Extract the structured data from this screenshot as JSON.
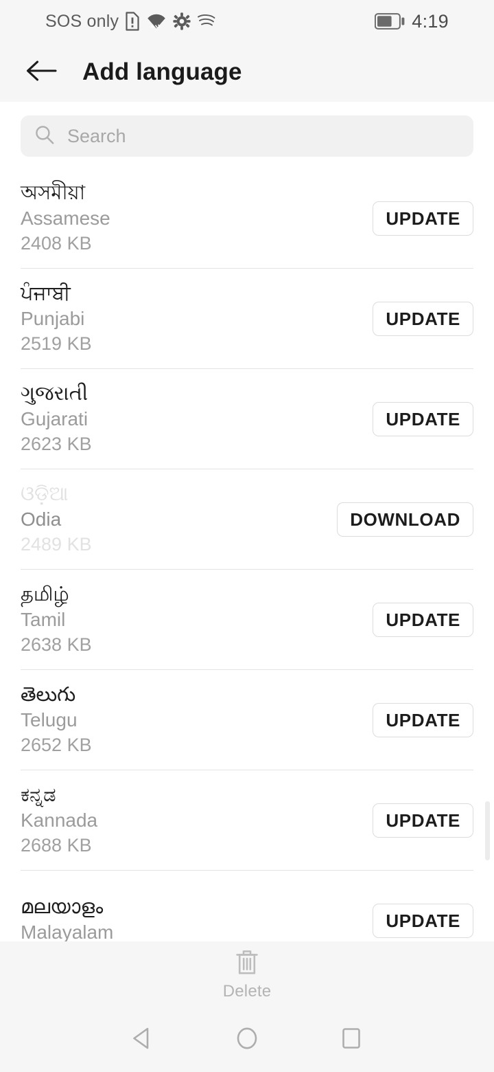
{
  "statusbar": {
    "carrier_text": "SOS only",
    "icons": [
      "sim-alert-icon",
      "wifi-icon",
      "gear-icon",
      "swiftkey-icon"
    ],
    "battery": "battery-icon",
    "battery_level_pct": 65,
    "time": "4:19"
  },
  "appbar": {
    "back_icon": "back-arrow-icon",
    "title": "Add language"
  },
  "search": {
    "icon": "search-icon",
    "placeholder": "Search",
    "value": ""
  },
  "list": {
    "items": [
      {
        "native": "অসমীয়া",
        "english": "Assamese",
        "size": "2408 KB",
        "action": "UPDATE",
        "dimmed": false
      },
      {
        "native": "ਪੰਜਾਬੀ",
        "english": "Punjabi",
        "size": "2519 KB",
        "action": "UPDATE",
        "dimmed": false
      },
      {
        "native": "ગુજરાતી",
        "english": "Gujarati",
        "size": "2623 KB",
        "action": "UPDATE",
        "dimmed": false
      },
      {
        "native": "ଓଡ଼ିଆ",
        "english": "Odia",
        "size": "2489 KB",
        "action": "DOWNLOAD",
        "dimmed": true
      },
      {
        "native": "தமிழ்",
        "english": "Tamil",
        "size": "2638 KB",
        "action": "UPDATE",
        "dimmed": false
      },
      {
        "native": "తెలుగు",
        "english": "Telugu",
        "size": "2652 KB",
        "action": "UPDATE",
        "dimmed": false
      },
      {
        "native": "ಕನ್ನಡ",
        "english": "Kannada",
        "size": "2688 KB",
        "action": "UPDATE",
        "dimmed": false
      },
      {
        "native": "മലയാളം",
        "english": "Malayalam",
        "size": "",
        "action": "UPDATE",
        "dimmed": false
      }
    ]
  },
  "bottom_bar": {
    "delete_icon": "trash-icon",
    "delete_label": "Delete",
    "enabled": false
  },
  "navbar": {
    "back": "nav-back-triangle-icon",
    "home": "nav-home-circle-icon",
    "recents": "nav-recents-square-icon"
  },
  "colors": {
    "chrome_bg": "#f6f6f6",
    "content_bg": "#ffffff",
    "search_bg": "#f1f1f1",
    "divider": "#e3e3e3",
    "primary_text": "#1e1e1e",
    "secondary_text": "#9b9b9b",
    "disabled_text": "#e0e0e0",
    "button_border": "#dcdcdc"
  }
}
